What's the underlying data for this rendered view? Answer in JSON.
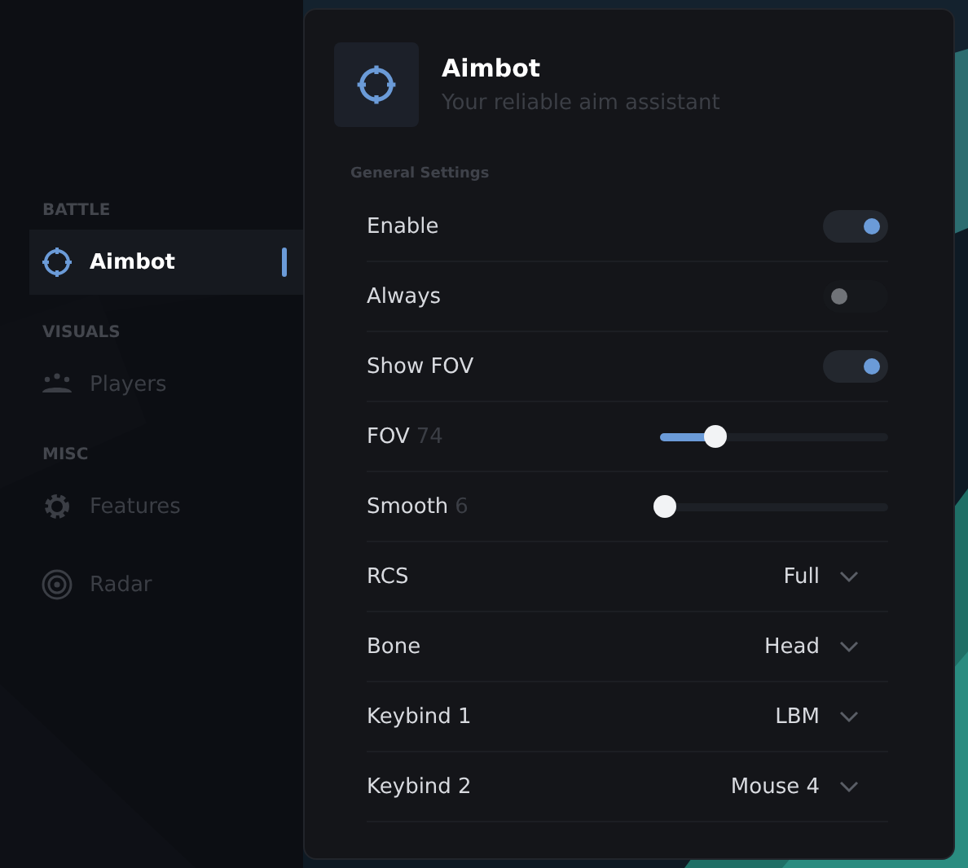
{
  "sidebar": {
    "sections": [
      {
        "header": "BATTLE",
        "items": [
          {
            "label": "Aimbot",
            "selected": true
          }
        ]
      },
      {
        "header": "VISUALS",
        "items": [
          {
            "label": "Players",
            "selected": false
          }
        ]
      },
      {
        "header": "MISC",
        "items": [
          {
            "label": "Features",
            "selected": false
          },
          {
            "label": "Radar",
            "selected": false
          }
        ]
      }
    ]
  },
  "panel": {
    "title": "Aimbot",
    "subtitle": "Your reliable aim assistant",
    "section": "General Settings",
    "rows": [
      {
        "kind": "toggle",
        "label": "Enable",
        "on": true
      },
      {
        "kind": "toggle",
        "label": "Always",
        "on": false
      },
      {
        "kind": "toggle",
        "label": "Show FOV",
        "on": true
      },
      {
        "kind": "slider",
        "label": "FOV",
        "value": "74",
        "level": 0.24
      },
      {
        "kind": "slider",
        "label": "Smooth",
        "value": "6",
        "level": 0.02
      },
      {
        "kind": "dropdown",
        "label": "RCS",
        "value": "Full"
      },
      {
        "kind": "dropdown",
        "label": "Bone",
        "value": "Head"
      },
      {
        "kind": "dropdown",
        "label": "Keybind 1",
        "value": "LBM"
      },
      {
        "kind": "dropdown",
        "label": "Keybind 2",
        "value": "Mouse 4"
      }
    ]
  }
}
